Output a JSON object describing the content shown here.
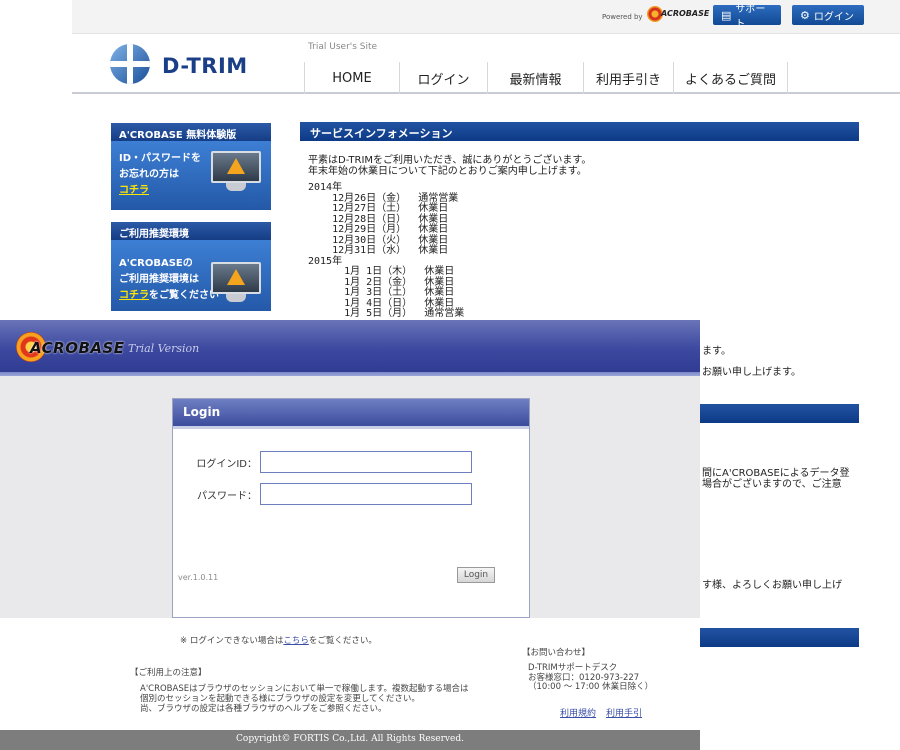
{
  "topbar": {
    "powered_by": "Powered by",
    "powered_logo": "ACROBASE",
    "support_label": "サポート",
    "login_label": "ログイン"
  },
  "site": {
    "name": "D-TRIM",
    "subtitle": "Trial User's Site",
    "nav": [
      "HOME",
      "ログイン",
      "最新情報",
      "利用手引き",
      "よくあるご質問"
    ]
  },
  "sidebar": {
    "box1_title": "A'CROBASE 無料体験版",
    "box1_lines": [
      "ID・パスワードを",
      "お忘れの方は"
    ],
    "box1_link": "コチラ",
    "box2_title": "ご利用推奨環境",
    "box2_lines": [
      "A'CROBASEの",
      "ご利用推奨環境は"
    ],
    "box2_link": "コチラ",
    "box2_suffix": "をご覧ください"
  },
  "main": {
    "service_title": "サービスインフォメーション",
    "intro": [
      "平素はD-TRIMをご利用いただき、誠にありがとうございます。",
      "年末年始の休業日について下記のとおりご案内申し上げます。"
    ],
    "holidays": "2014年\n    12月26日（金）  通常営業\n    12月27日（土）  休業日\n    12月28日（日）  休業日\n    12月29日（月）  休業日\n    12月30日（火）  休業日\n    12月31日（水）  休業日\n2015年\n      1月 1日（木）  休業日\n      1月 2日（金）  休業日\n      1月 3日（土）  休業日\n      1月 4日（日）  休業日\n      1月 5日（月）  通常営業",
    "frag1": "ます。",
    "frag2": "お願い申し上げます。",
    "frag3a": "間にA'CROBASEによるデータ登",
    "frag3b": "場合がございますので、ご注意",
    "frag4": "す様、よろしくお願い申し上げ"
  },
  "acrobase": {
    "logo_text": "ACROBASE",
    "trial_text": "Trial Version",
    "login_title": "Login",
    "id_label": "ログインID：",
    "pw_label": "パスワード：",
    "id_value": "",
    "pw_value": "",
    "version": "ver.1.0.11",
    "login_button": "Login",
    "note_pre": "※ ログインできない場合は",
    "note_link": "こちら",
    "note_post": "をご覧ください。",
    "caution_head": "【ご利用上の注意】",
    "caution_body": [
      "A'CROBASEはブラウザのセッションにおいて単一で稼働します。複数起動する場合は",
      "個別のセッションを起動できる様にブラウザの設定を変更してください。",
      "尚、ブラウザの設定は各種ブラウザのヘルプをご参照ください。"
    ],
    "contact_head": "【お問い合わせ】",
    "contact_body": [
      "D-TRIMサポートデスク",
      "お客様窓口：0120-973-227",
      "（10:00 ～ 17:00  休業日除く）"
    ],
    "link_terms": "利用規約",
    "link_guide": "利用手引",
    "copyright": "Copyright© FORTIS Co.,Ltd. All Rights Reserved."
  },
  "colors": {
    "brand_blue": "#1b3f86",
    "bar_blue": "#0d3a86",
    "acro_header": "#3d4aa0",
    "link_yellow": "#ffe600"
  }
}
